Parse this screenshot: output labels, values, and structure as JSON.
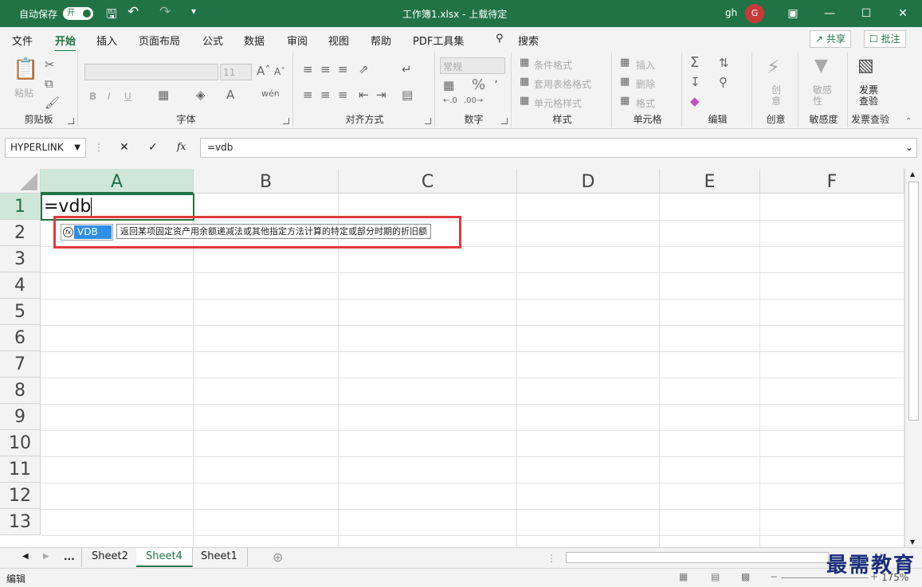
{
  "titlebar": {
    "autosave": "自动保存",
    "toggle": "开",
    "title": "工作簿1.xlsx  -  上载待定",
    "user": "gh",
    "avatar": "G"
  },
  "tabs": [
    "文件",
    "开始",
    "插入",
    "页面布局",
    "公式",
    "数据",
    "审阅",
    "视图",
    "帮助",
    "PDF工具集"
  ],
  "search": "搜索",
  "share": "共享",
  "comments": "批注",
  "ribbon": {
    "clipboard": {
      "label": "剪贴板",
      "paste": "粘贴"
    },
    "font": {
      "label": "字体",
      "size": "11",
      "bold": "B",
      "italic": "I",
      "underline": "U"
    },
    "align": {
      "label": "对齐方式"
    },
    "number": {
      "label": "数字",
      "format": "常规",
      "percent": "%"
    },
    "styles": {
      "label": "样式",
      "cond": "条件格式",
      "table": "套用表格格式",
      "cell": "单元格样式"
    },
    "cells": {
      "label": "单元格",
      "insert": "插入",
      "delete": "删除",
      "format": "格式"
    },
    "editing": {
      "label": "编辑"
    },
    "creative": {
      "label": "创意",
      "btn": "创\n意"
    },
    "sensitivity": {
      "label": "敏感度",
      "btn": "敏感\n性"
    },
    "invoice": {
      "label": "发票查验",
      "btn": "发票\n查验"
    }
  },
  "formulabar": {
    "namebox": "HYPERLINK",
    "fx": "fx",
    "formula": "=vdb"
  },
  "columns": [
    "A",
    "B",
    "C",
    "D",
    "E",
    "F"
  ],
  "rows": [
    "1",
    "2",
    "3",
    "4",
    "5",
    "6",
    "7",
    "8",
    "9",
    "10",
    "11",
    "12",
    "13"
  ],
  "cell_a1": "=vdb",
  "autocomplete": {
    "item": "VDB",
    "tooltip": "返回某项固定资产用余额递减法或其他指定方法计算的特定或部分时期的折旧额"
  },
  "sheets": {
    "ellipsis": "...",
    "tabs": [
      "Sheet2",
      "Sheet4",
      "Sheet1"
    ],
    "active": "Sheet4"
  },
  "status": {
    "mode": "编辑",
    "zoom": "175%"
  },
  "watermark": "最需教育"
}
